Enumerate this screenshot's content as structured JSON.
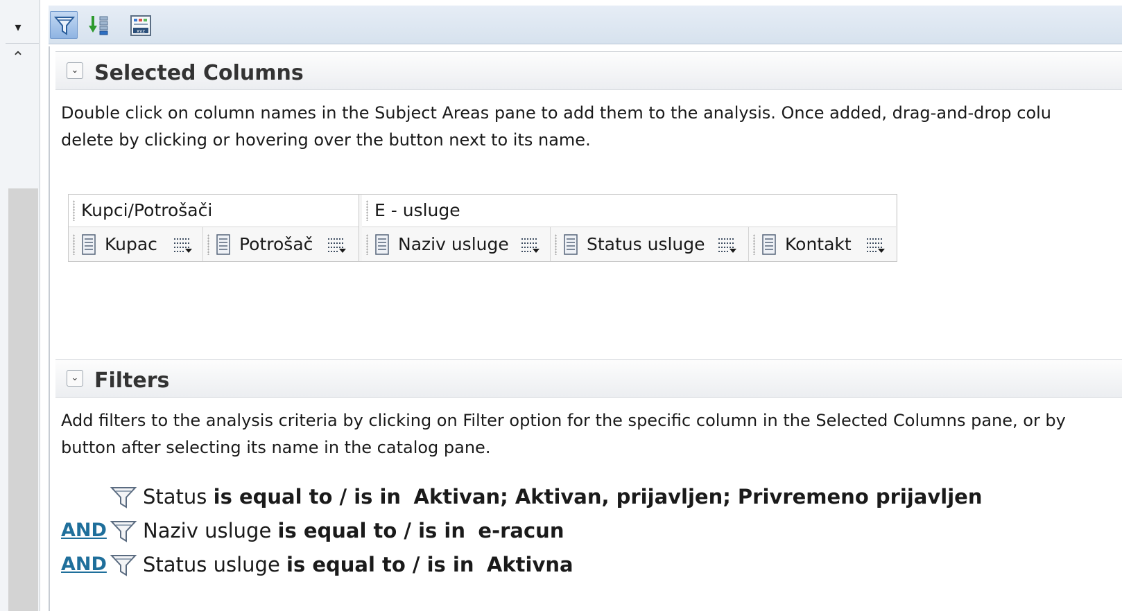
{
  "toolbar": {
    "buttons": [
      "filter-icon",
      "sort-icon",
      "xyz-icon"
    ]
  },
  "selected_columns": {
    "title": "Selected Columns",
    "desc_line1": "Double click on column names in the Subject Areas pane to add them to the analysis. Once added, drag-and-drop colu",
    "desc_line2": "delete by clicking or hovering over the button next to its name.",
    "groups": [
      {
        "label": "Kupci/Potrošači",
        "columns": [
          "Kupac",
          "Potrošač"
        ]
      },
      {
        "label": "E - usluge",
        "columns": [
          "Naziv usluge",
          "Status usluge",
          "Kontakt"
        ]
      }
    ]
  },
  "filters": {
    "title": "Filters",
    "desc_line1": "Add filters to the analysis criteria by clicking on Filter option for the specific column in the Selected Columns pane, or by",
    "desc_line2": "button after selecting its name in the catalog pane.",
    "rows": [
      {
        "connector": "",
        "column": "Status",
        "operator": "is equal to / is in",
        "values": "Aktivan; Aktivan, prijavljen; Privremeno prijavljen"
      },
      {
        "connector": "AND",
        "column": "Naziv usluge",
        "operator": "is equal to / is in",
        "values": "e-racun"
      },
      {
        "connector": "AND",
        "column": "Status usluge",
        "operator": "is equal to / is in",
        "values": "Aktivna"
      }
    ]
  }
}
